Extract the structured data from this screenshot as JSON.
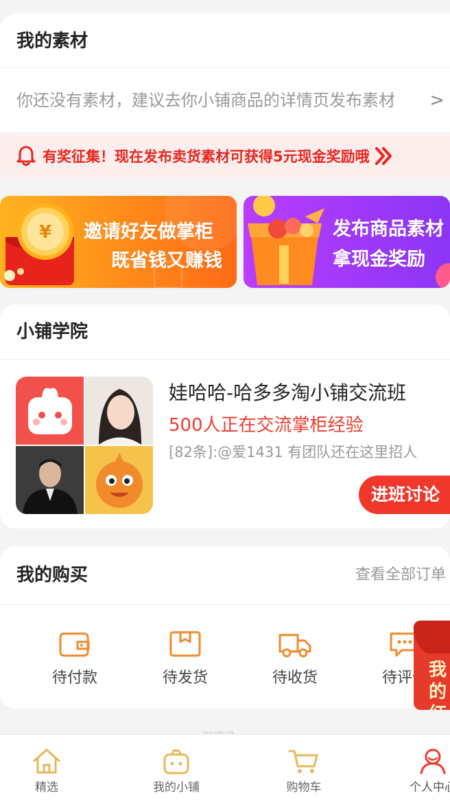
{
  "materials": {
    "title": "我的素材",
    "empty_text": "你还没有素材，建议去你小铺商品的详情页发布素材",
    "chevron": ">"
  },
  "notice": {
    "text": "有奖征集！现在发布卖货素材可获得5元现金奖励哦",
    "icon": "bell-icon",
    "color": "#e8261f"
  },
  "banners": {
    "invite": {
      "line1": "邀请好友做掌柜",
      "line2": "既省钱又赚钱",
      "currency": "¥"
    },
    "publish": {
      "line1": "发布商品素材",
      "line2": "拿现金奖励"
    }
  },
  "academy": {
    "title": "小铺学院",
    "group": {
      "name": "娃哈哈-哈多多淘小铺交流班",
      "subtitle": "500人正在交流掌柜经验",
      "latest_message": "[82条]:@爱1431 有团队还在这里招人",
      "join_label": "进班讨论"
    }
  },
  "purchase": {
    "title": "我的购买",
    "view_all": "查看全部订单",
    "orders": [
      {
        "label": "待付款",
        "icon": "wallet-icon"
      },
      {
        "label": "待发货",
        "icon": "package-icon"
      },
      {
        "label": "待收货",
        "icon": "truck-icon"
      },
      {
        "label": "待评价",
        "icon": "comment-icon"
      }
    ]
  },
  "float_packet": {
    "text": "我的红包"
  },
  "peek_text": "· 到底了 ·",
  "nav": [
    {
      "label": "精选",
      "icon": "home-icon"
    },
    {
      "label": "我的小铺",
      "icon": "shop-icon"
    },
    {
      "label": "购物车",
      "icon": "cart-icon"
    },
    {
      "label": "个人中心",
      "icon": "user-icon",
      "active": true
    }
  ],
  "colors": {
    "accent_red": "#f0372b",
    "order_icon_orange": "#f08a2a",
    "nav_icon_gold": "#e9b85a",
    "nav_active_red": "#ef3b2f"
  }
}
